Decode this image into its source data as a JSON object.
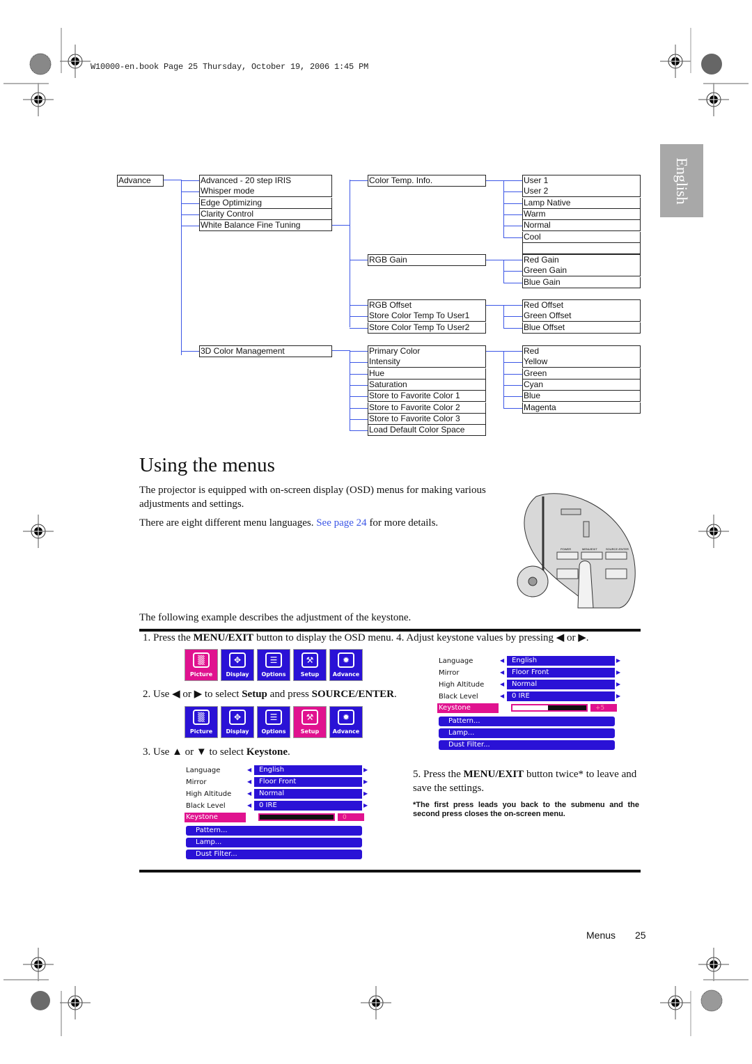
{
  "header": {
    "print_line": "W10000-en.book  Page 25  Thursday, October 19, 2006  1:45 PM"
  },
  "side_tab": {
    "label": "English"
  },
  "menu_tree": {
    "root": "Advance",
    "level1": [
      "Advanced - 20 step IRIS",
      "Whisper mode",
      "Edge Optimizing",
      "Clarity Control",
      "White Balance Fine Tuning",
      "3D Color Management"
    ],
    "white_balance_children": [
      "Color Temp. Info.",
      "RGB Gain",
      "RGB Offset",
      "Store Color Temp To User1",
      "Store Color Temp To User2"
    ],
    "color_temp_children": [
      "User 1",
      "User 2",
      "Lamp Native",
      "Warm",
      "Normal",
      "Cool",
      ""
    ],
    "rgb_gain_children": [
      "Red Gain",
      "Green Gain",
      "Blue Gain"
    ],
    "rgb_offset_children": [
      "Red Offset",
      "Green Offset",
      "Blue Offset"
    ],
    "color_mgmt_children": [
      "Primary Color",
      "Intensity",
      "Hue",
      "Saturation",
      "Store to Favorite Color 1",
      "Store to Favorite Color 2",
      "Store to Favorite Color 3",
      "Load Default Color Space"
    ],
    "primary_color_children": [
      "Red",
      "Yellow",
      "Green",
      "Cyan",
      "Blue",
      "Magenta"
    ]
  },
  "section": {
    "title": "Using the menus",
    "para1": "The projector is equipped with on-screen display (OSD) menus for making various adjustments and settings.",
    "para2_pre": "There are eight different menu languages. ",
    "para2_link": "See page 24",
    "para2_post": " for more details.",
    "example_intro": "The following example describes the adjustment of the keystone."
  },
  "remote_image": {
    "labels": [
      "POWER",
      "MENU/EXIT",
      "SOURCE /ENTER"
    ]
  },
  "steps": {
    "step1_pre": "1.  Press the ",
    "step1_bold": "MENU/EXIT",
    "step1_post": " button to display the OSD menu. 4.  Adjust keystone values by pressing ◀ or ▶.",
    "step2_pre": "2.  Use ◀ or ▶ to select ",
    "step2_bold1": "Setup",
    "step2_mid": " and press ",
    "step2_bold2": "SOURCE/ENTER",
    "step2_post": ".",
    "step3_pre": "3.  Use ▲ or ▼ to select ",
    "step3_bold": "Keystone",
    "step3_post": ".",
    "step5_pre": "5.  Press the ",
    "step5_bold": "MENU/EXIT",
    "step5_post": " button twice* to leave and save the settings.",
    "footnote": "*The first press leads you back to the submenu and the second press closes the on-screen menu."
  },
  "osd_tabs": {
    "items": [
      {
        "label": "Picture",
        "icon": "picture-icon",
        "glyph": "▒"
      },
      {
        "label": "Display",
        "icon": "display-icon",
        "glyph": "✥"
      },
      {
        "label": "Options",
        "icon": "options-icon",
        "glyph": "☰"
      },
      {
        "label": "Setup",
        "icon": "tools-icon",
        "glyph": "⚒"
      },
      {
        "label": "Advance",
        "icon": "sparkle-icon",
        "glyph": "✹"
      }
    ],
    "step1_active": "Picture",
    "step2_active": "Setup"
  },
  "osd_setup": {
    "rows": [
      {
        "name": "Language",
        "value": "English"
      },
      {
        "name": "Mirror",
        "value": "Floor Front"
      },
      {
        "name": "High Altitude",
        "value": "Normal"
      },
      {
        "name": "Black Level",
        "value": "0 IRE"
      }
    ],
    "keystone_label": "Keystone",
    "submenus": [
      "Pattern...",
      "Lamp...",
      "Dust Filter..."
    ],
    "step3_keystone_value": "0",
    "step3_keystone_fill": 0,
    "step4_keystone_value": "+5",
    "step4_keystone_fill": 0.48
  },
  "footer": {
    "section": "Menus",
    "page": "25"
  },
  "colors": {
    "osd_blue": "#2a12d6",
    "osd_magenta": "#e0128f",
    "tree_line": "#3b56e6",
    "link": "#3b56e6",
    "tab_gray": "#a8a8a8"
  }
}
